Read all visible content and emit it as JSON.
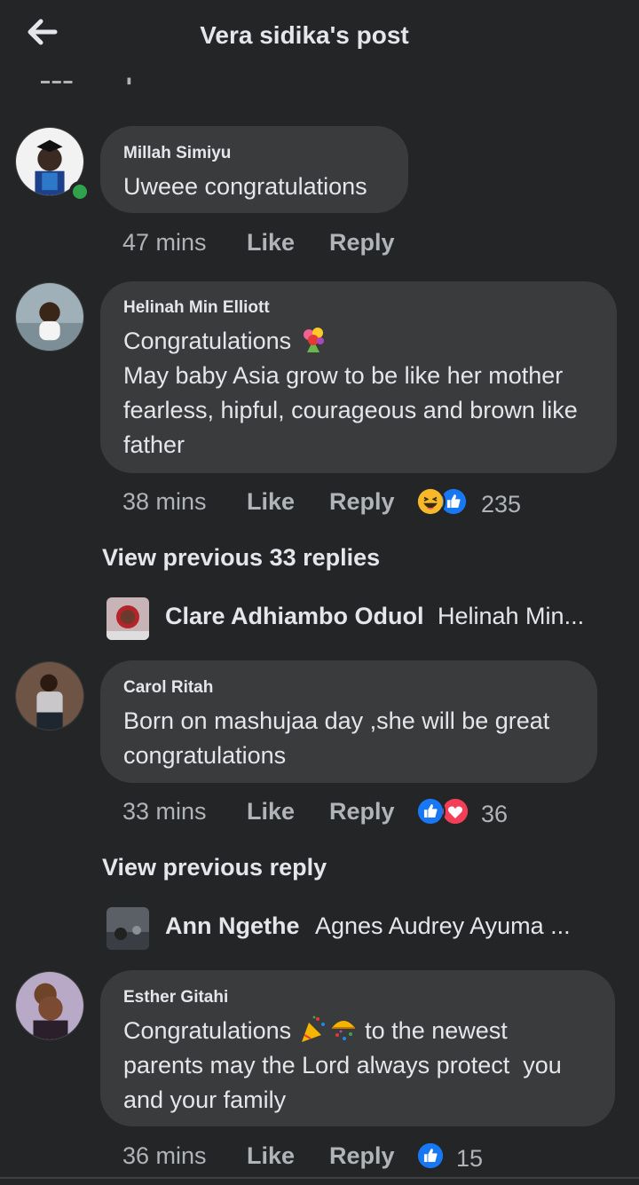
{
  "header": {
    "title": "Vera sidika's post",
    "back_icon": "back-arrow-icon"
  },
  "colors": {
    "background": "#242526",
    "bubble": "#3a3b3c",
    "text": "#e4e6eb",
    "secondary": "#b0b3b8",
    "like_blue": "#1877f2",
    "love_red": "#f33e58",
    "online": "#31a24c"
  },
  "labels": {
    "like": "Like",
    "reply": "Reply"
  },
  "comments": [
    {
      "author": "Millah Simiyu",
      "text": "Uweee congratulations",
      "time": "47 mins",
      "online": true
    },
    {
      "author": "Helinah Min Elliott",
      "text_line1": "Congratulations",
      "text_rest": "May baby Asia grow to be like her mother fearless, hipful, courageous and brown like father",
      "emoji": "bouquet",
      "time": "38 mins",
      "reactions": [
        "haha",
        "like"
      ],
      "reaction_count": "235"
    },
    {
      "author": "Carol Ritah",
      "text": "Born on mashujaa day ,she will be great congratulations",
      "time": "33 mins",
      "reactions": [
        "like",
        "love"
      ],
      "reaction_count": "36"
    },
    {
      "author": "Esther Gitahi",
      "text_before": "Congratulations",
      "emojis": [
        "party-popper",
        "confetti-ball"
      ],
      "text_after": "to the newest parents may the Lord always protect  you and your family",
      "time": "36 mins",
      "reactions": [
        "like"
      ],
      "reaction_count": "15"
    }
  ],
  "view_previous": [
    {
      "label": "View previous 33 replies"
    },
    {
      "label": "View previous reply"
    }
  ],
  "reply_previews": [
    {
      "name": "Clare Adhiambo Oduol",
      "text": "Helinah Min..."
    },
    {
      "name": "Ann Ngethe",
      "text": "Agnes Audrey Ayuma ..."
    }
  ]
}
